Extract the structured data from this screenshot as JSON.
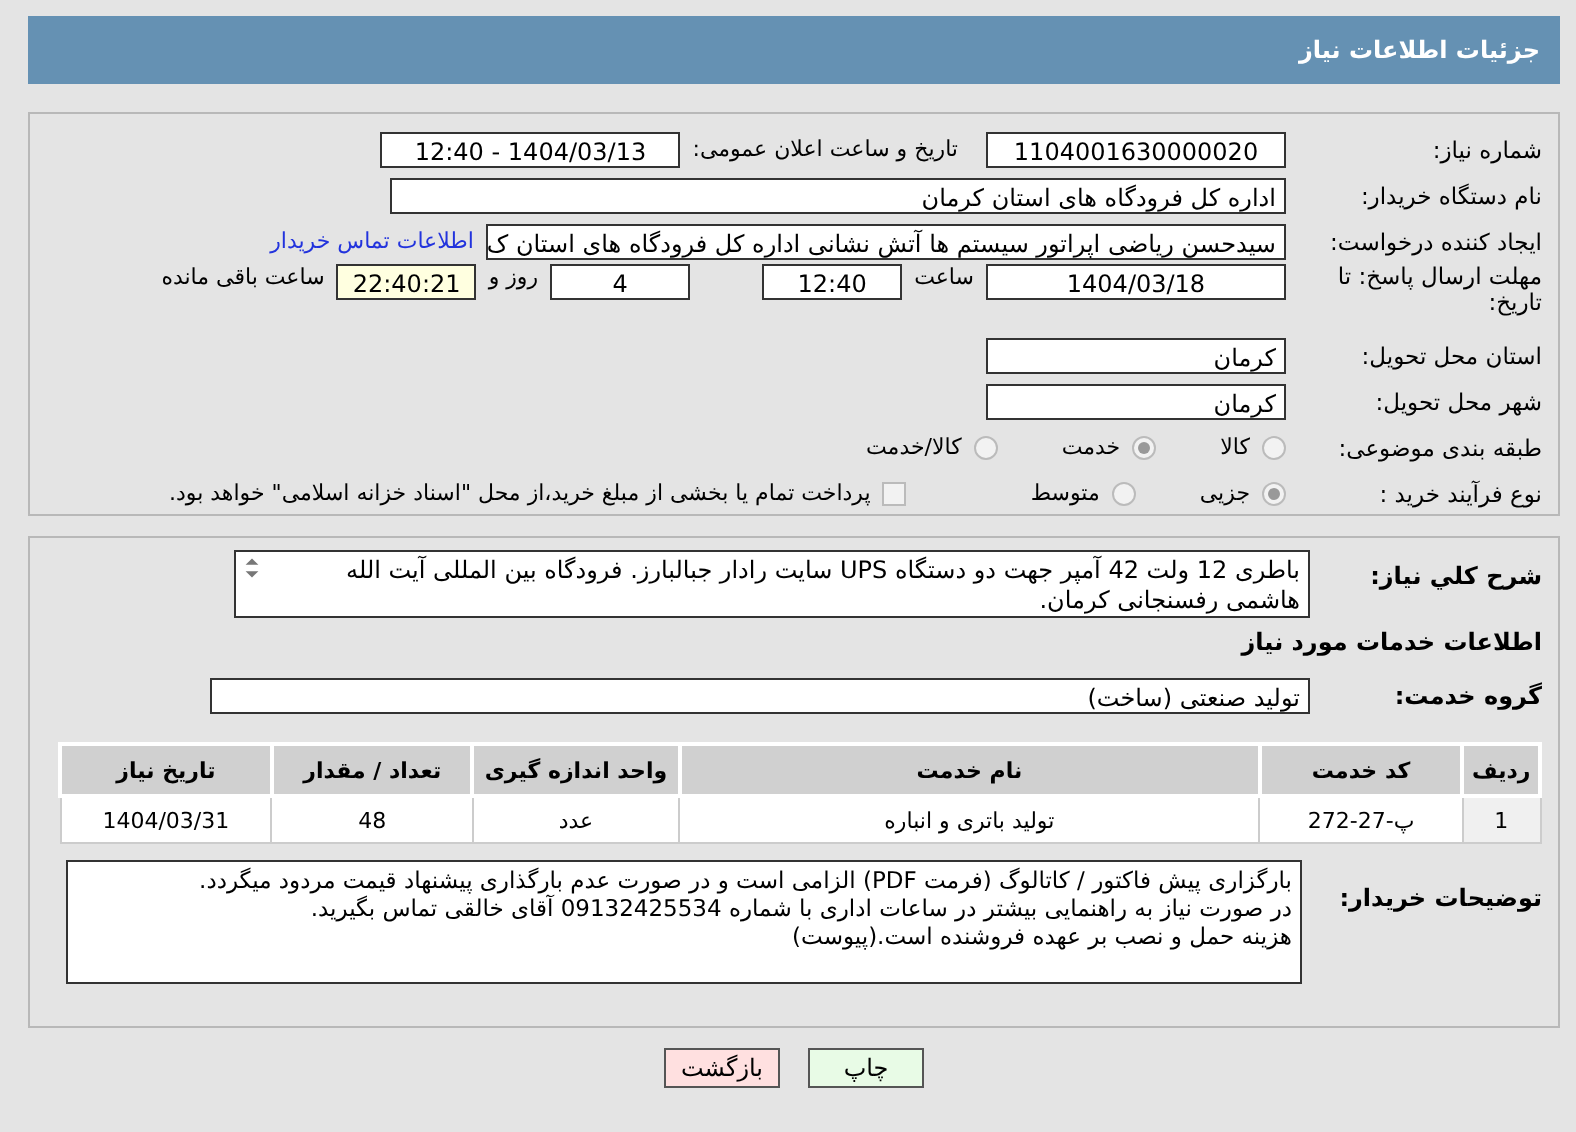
{
  "header": {
    "title": "جزئیات اطلاعات نیاز"
  },
  "details": {
    "need_number": {
      "label": "شماره نیاز:",
      "value": "1104001630000020"
    },
    "announce": {
      "label": "تاریخ و ساعت اعلان عمومی:",
      "value": "1404/03/13 - 12:40"
    },
    "buyer_org": {
      "label": "نام دستگاه خریدار:",
      "value": "اداره کل فرودگاه های استان کرمان"
    },
    "requester": {
      "label": "ایجاد کننده درخواست:",
      "value": "سیدحسن ریاضی اپراتور سیستم ها آتش نشانی اداره کل فرودگاه های استان ک",
      "link": "اطلاعات تماس خریدار"
    },
    "deadline": {
      "label": "مهلت ارسال پاسخ: تا تاریخ:",
      "date": "1404/03/18",
      "time_label": "ساعت",
      "time": "12:40",
      "days": "4",
      "days_label": "روز و",
      "remaining": "22:40:21",
      "remaining_label": "ساعت باقی مانده"
    },
    "province": {
      "label": "استان محل تحویل:",
      "value": "کرمان"
    },
    "city": {
      "label": "شهر محل تحویل:",
      "value": "کرمان"
    },
    "category": {
      "label": "طبقه بندی موضوعی:",
      "options": [
        {
          "label": "کالا",
          "selected": false
        },
        {
          "label": "خدمت",
          "selected": true
        },
        {
          "label": "کالا/خدمت",
          "selected": false
        }
      ]
    },
    "process": {
      "label": "نوع فرآیند خرید :",
      "options": [
        {
          "label": "جزیی",
          "selected": true
        },
        {
          "label": "متوسط",
          "selected": false
        }
      ],
      "payment": {
        "checked": false,
        "label": "پرداخت تمام یا بخشی از مبلغ خرید،از محل \"اسناد خزانه اسلامی\" خواهد بود."
      }
    }
  },
  "need": {
    "description": {
      "label": "شرح کلي نياز:",
      "value": "باطری 12 ولت 42 آمپر جهت دو دستگاه  UPS سایت رادار جبالبارز. فرودگاه بین المللی آیت الله هاشمی رفسنجانی کرمان."
    },
    "services_title": "اطلاعات خدمات مورد نیاز",
    "service_group": {
      "label": "گروه خدمت:",
      "value": "تولید صنعتی (ساخت)"
    },
    "table": {
      "columns": [
        "ردیف",
        "کد خدمت",
        "نام خدمت",
        "واحد اندازه گیری",
        "تعداد / مقدار",
        "تاریخ نیاز"
      ],
      "rows": [
        [
          "1",
          "پ-27-272",
          "تولید باتری و انباره",
          "عدد",
          "48",
          "1404/03/31"
        ]
      ]
    },
    "buyer_notes": {
      "label": "توضیحات خریدار:",
      "lines": [
        "بارگزاری پیش فاکتور / کاتالوگ (فرمت PDF) الزامی است و در صورت عدم بارگذاری پیشنهاد قیمت مردود میگردد.",
        "در صورت نیاز به راهنمایی بیشتر در ساعات اداری با شماره 09132425534 آقای خالقی تماس بگیرید.",
        "هزینه حمل و نصب بر عهده فروشنده است.(پیوست)"
      ]
    }
  },
  "buttons": [
    {
      "label": "چاپ",
      "kind": "print"
    },
    {
      "label": "بازگشت",
      "kind": "back"
    }
  ]
}
